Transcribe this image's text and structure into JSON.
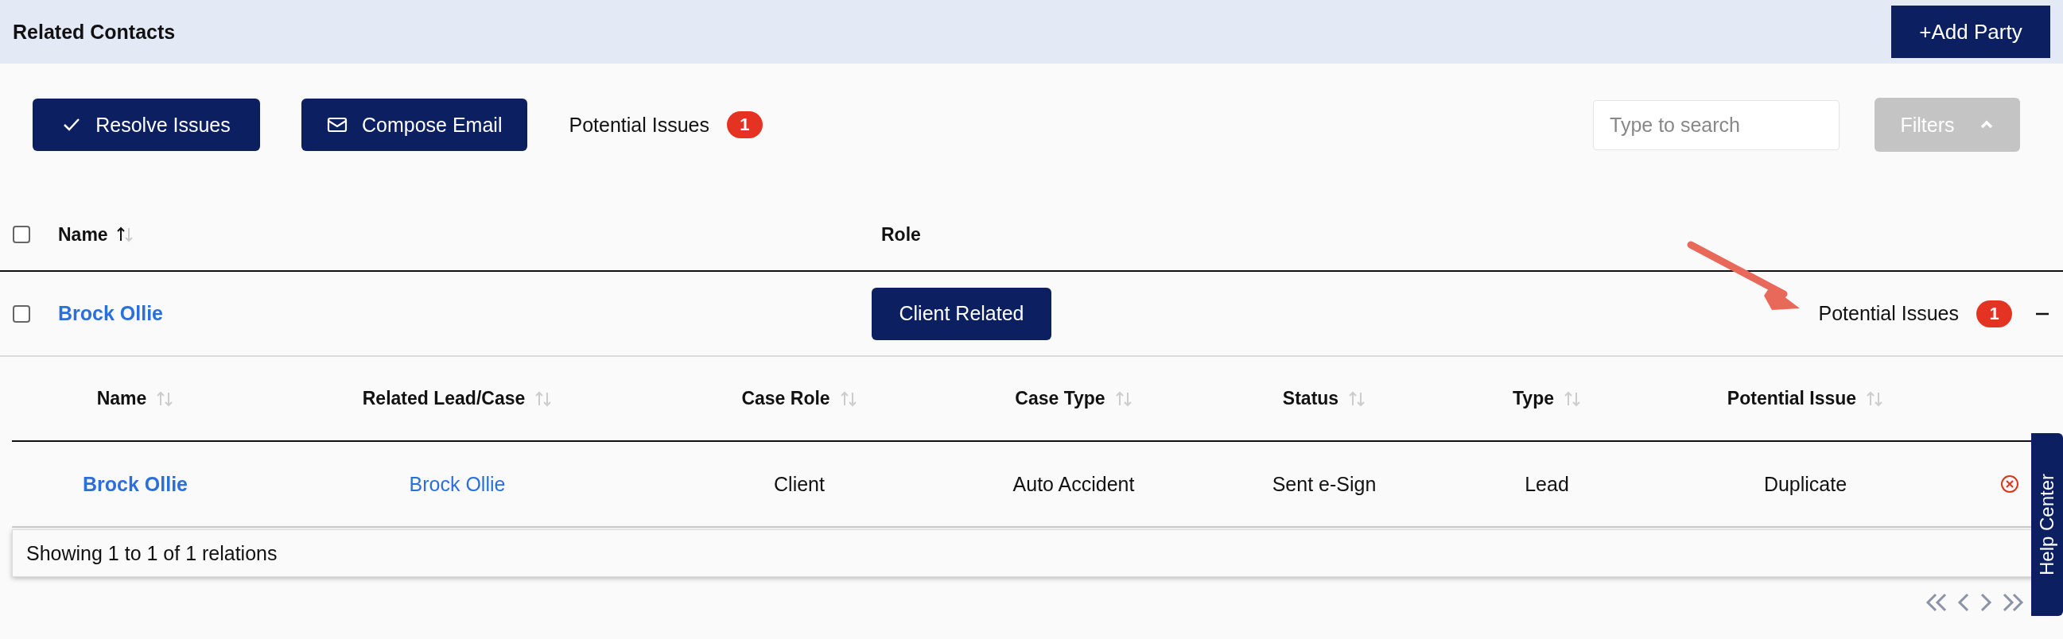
{
  "header": {
    "title": "Related Contacts",
    "add_button": "+Add Party"
  },
  "toolbar": {
    "resolve_button": "Resolve Issues",
    "compose_button": "Compose Email",
    "issues_label": "Potential Issues",
    "issues_count": "1",
    "search": {
      "placeholder": "Type to search"
    },
    "filters_button": {
      "label": "Filters",
      "disabled": true,
      "expanded": true
    }
  },
  "table": {
    "select_all": {
      "checked": false
    },
    "columns": [
      {
        "label": "Name",
        "sorted_ascending": true
      },
      {
        "label": "Role"
      }
    ],
    "rows": [
      {
        "checked": false,
        "name": "Brock Ollie",
        "role": "Client Related",
        "issues_label": "Potential Issues",
        "issues_count": "1",
        "expanded": true,
        "detail": {
          "columns": [
            {
              "label": "Name",
              "sortable": true,
              "sorted_ascending": false
            },
            {
              "label": "Related Lead/Case",
              "sortable": true,
              "sorted_ascending": false
            },
            {
              "label": "Case Role",
              "sortable": true,
              "sorted_ascending": false
            },
            {
              "label": "Case Type",
              "sortable": true,
              "sorted_ascending": false
            },
            {
              "label": "Status",
              "sortable": true,
              "sorted_ascending": false
            },
            {
              "label": "Type",
              "sortable": true,
              "sorted_ascending": false
            },
            {
              "label": "Potential Issue",
              "sortable": true,
              "sorted_ascending": false
            }
          ],
          "rows": [
            {
              "cells": [
                "Brock Ollie",
                "Brock Ollie",
                "Client",
                "Auto Accident",
                "Sent e-Sign",
                "Lead",
                "Duplicate"
              ]
            }
          ],
          "footer": "Showing 1 to 1 of 1 relations"
        }
      }
    ]
  },
  "help_tab": "Help Center"
}
